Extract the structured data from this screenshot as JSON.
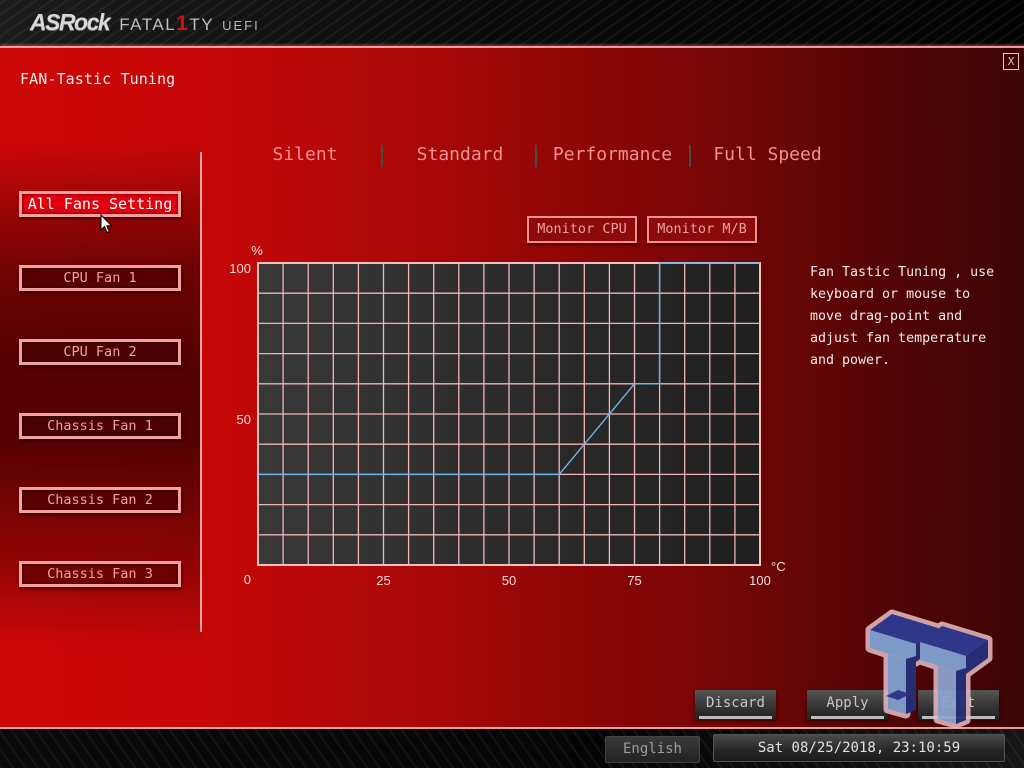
{
  "header": {
    "brand": "ASRock",
    "product_pre": "FATAL",
    "product_one": "1",
    "product_post": "TY",
    "suffix": "UEFI"
  },
  "page": {
    "title": "FAN-Tastic Tuning",
    "close_label": "X"
  },
  "sidebar": {
    "items": [
      {
        "label": "All Fans Setting",
        "active": true
      },
      {
        "label": "CPU Fan 1",
        "active": false
      },
      {
        "label": "CPU Fan 2",
        "active": false
      },
      {
        "label": "Chassis Fan 1",
        "active": false
      },
      {
        "label": "Chassis Fan 2",
        "active": false
      },
      {
        "label": "Chassis Fan 3",
        "active": false
      }
    ]
  },
  "modes": {
    "items": [
      {
        "label": "Silent"
      },
      {
        "label": "Standard"
      },
      {
        "label": "Performance"
      },
      {
        "label": "Full Speed"
      }
    ]
  },
  "monitors": {
    "cpu_label": "Monitor CPU",
    "mb_label": "Monitor M/B"
  },
  "help": {
    "lines": [
      "Fan Tastic Tuning , use",
      "keyboard or mouse to",
      "move drag-point and",
      "adjust fan temperature",
      "and power."
    ]
  },
  "actions": {
    "discard_label": "Discard",
    "apply_label": "Apply",
    "exit_label": "Exit"
  },
  "footer": {
    "language": "English",
    "datetime": "Sat 08/25/2018, 23:10:59"
  },
  "colors": {
    "accent": "#e0020e",
    "curve": "#72b4e6",
    "grid": "#f2b4b4"
  },
  "chart_data": {
    "type": "line",
    "title": "",
    "xlabel": "°C",
    "ylabel": "%",
    "xlim": [
      0,
      100
    ],
    "ylim": [
      0,
      100
    ],
    "x_ticks": [
      25,
      50,
      75,
      100
    ],
    "y_ticks": [
      0,
      50,
      100
    ],
    "grid": {
      "on": true,
      "x_step": 5,
      "y_step": 10
    },
    "series": [
      {
        "name": "All Fans",
        "points": [
          [
            0,
            30
          ],
          [
            60,
            30
          ],
          [
            75,
            60
          ],
          [
            80,
            60
          ],
          [
            80,
            100
          ],
          [
            100,
            100
          ]
        ]
      }
    ]
  }
}
